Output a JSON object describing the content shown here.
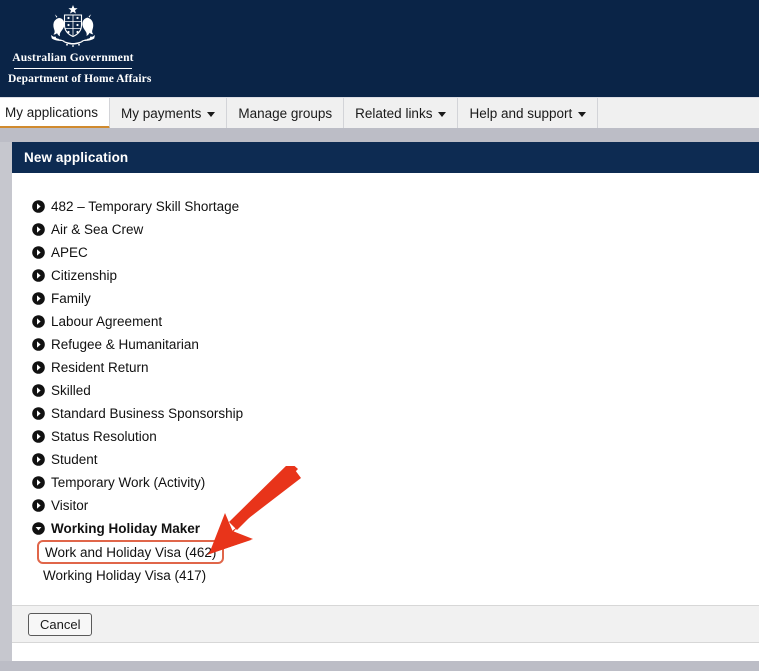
{
  "brand": {
    "crest_icon": "australian-coat-of-arms",
    "line1": "Australian Government",
    "line2": "Department of Home Affairs"
  },
  "colors": {
    "navy": "#0a2447",
    "panel_header_navy": "#0d2b52",
    "active_tab_underline": "#d08a2e",
    "annotation_red": "#e8341a",
    "highlight_border": "#e0664a",
    "grey_band": "#bcbdc6",
    "footer_grey": "#f1f1f1"
  },
  "nav": {
    "items": [
      {
        "label": "My applications",
        "active": true,
        "has_caret": false
      },
      {
        "label": "My payments",
        "active": false,
        "has_caret": true
      },
      {
        "label": "Manage groups",
        "active": false,
        "has_caret": false
      },
      {
        "label": "Related links",
        "active": false,
        "has_caret": true
      },
      {
        "label": "Help and support",
        "active": false,
        "has_caret": true
      }
    ]
  },
  "panel": {
    "header_title": "New application",
    "categories": [
      {
        "label": "482 – Temporary Skill Shortage",
        "icon": "chevron-right-circle-icon",
        "expanded": false
      },
      {
        "label": "Air & Sea Crew",
        "icon": "chevron-right-circle-icon",
        "expanded": false
      },
      {
        "label": "APEC",
        "icon": "chevron-right-circle-icon",
        "expanded": false
      },
      {
        "label": "Citizenship",
        "icon": "chevron-right-circle-icon",
        "expanded": false
      },
      {
        "label": "Family",
        "icon": "chevron-right-circle-icon",
        "expanded": false
      },
      {
        "label": "Labour Agreement",
        "icon": "chevron-right-circle-icon",
        "expanded": false
      },
      {
        "label": "Refugee & Humanitarian",
        "icon": "chevron-right-circle-icon",
        "expanded": false
      },
      {
        "label": "Resident Return",
        "icon": "chevron-right-circle-icon",
        "expanded": false
      },
      {
        "label": "Skilled",
        "icon": "chevron-right-circle-icon",
        "expanded": false
      },
      {
        "label": "Standard Business Sponsorship",
        "icon": "chevron-right-circle-icon",
        "expanded": false
      },
      {
        "label": "Status Resolution",
        "icon": "chevron-right-circle-icon",
        "expanded": false
      },
      {
        "label": "Student",
        "icon": "chevron-right-circle-icon",
        "expanded": false
      },
      {
        "label": "Temporary Work (Activity)",
        "icon": "chevron-right-circle-icon",
        "expanded": false
      },
      {
        "label": "Visitor",
        "icon": "chevron-right-circle-icon",
        "expanded": false
      },
      {
        "label": "Working Holiday Maker",
        "icon": "chevron-down-circle-icon",
        "expanded": true
      }
    ],
    "subitems": [
      {
        "label": "Work and Holiday Visa (462)",
        "highlighted": true
      },
      {
        "label": "Working Holiday Visa (417)",
        "highlighted": false
      }
    ],
    "cancel_label": "Cancel"
  },
  "annotation": {
    "arrow_icon": "arrow-down-left-icon",
    "target_label": "Work and Holiday Visa (462)"
  }
}
